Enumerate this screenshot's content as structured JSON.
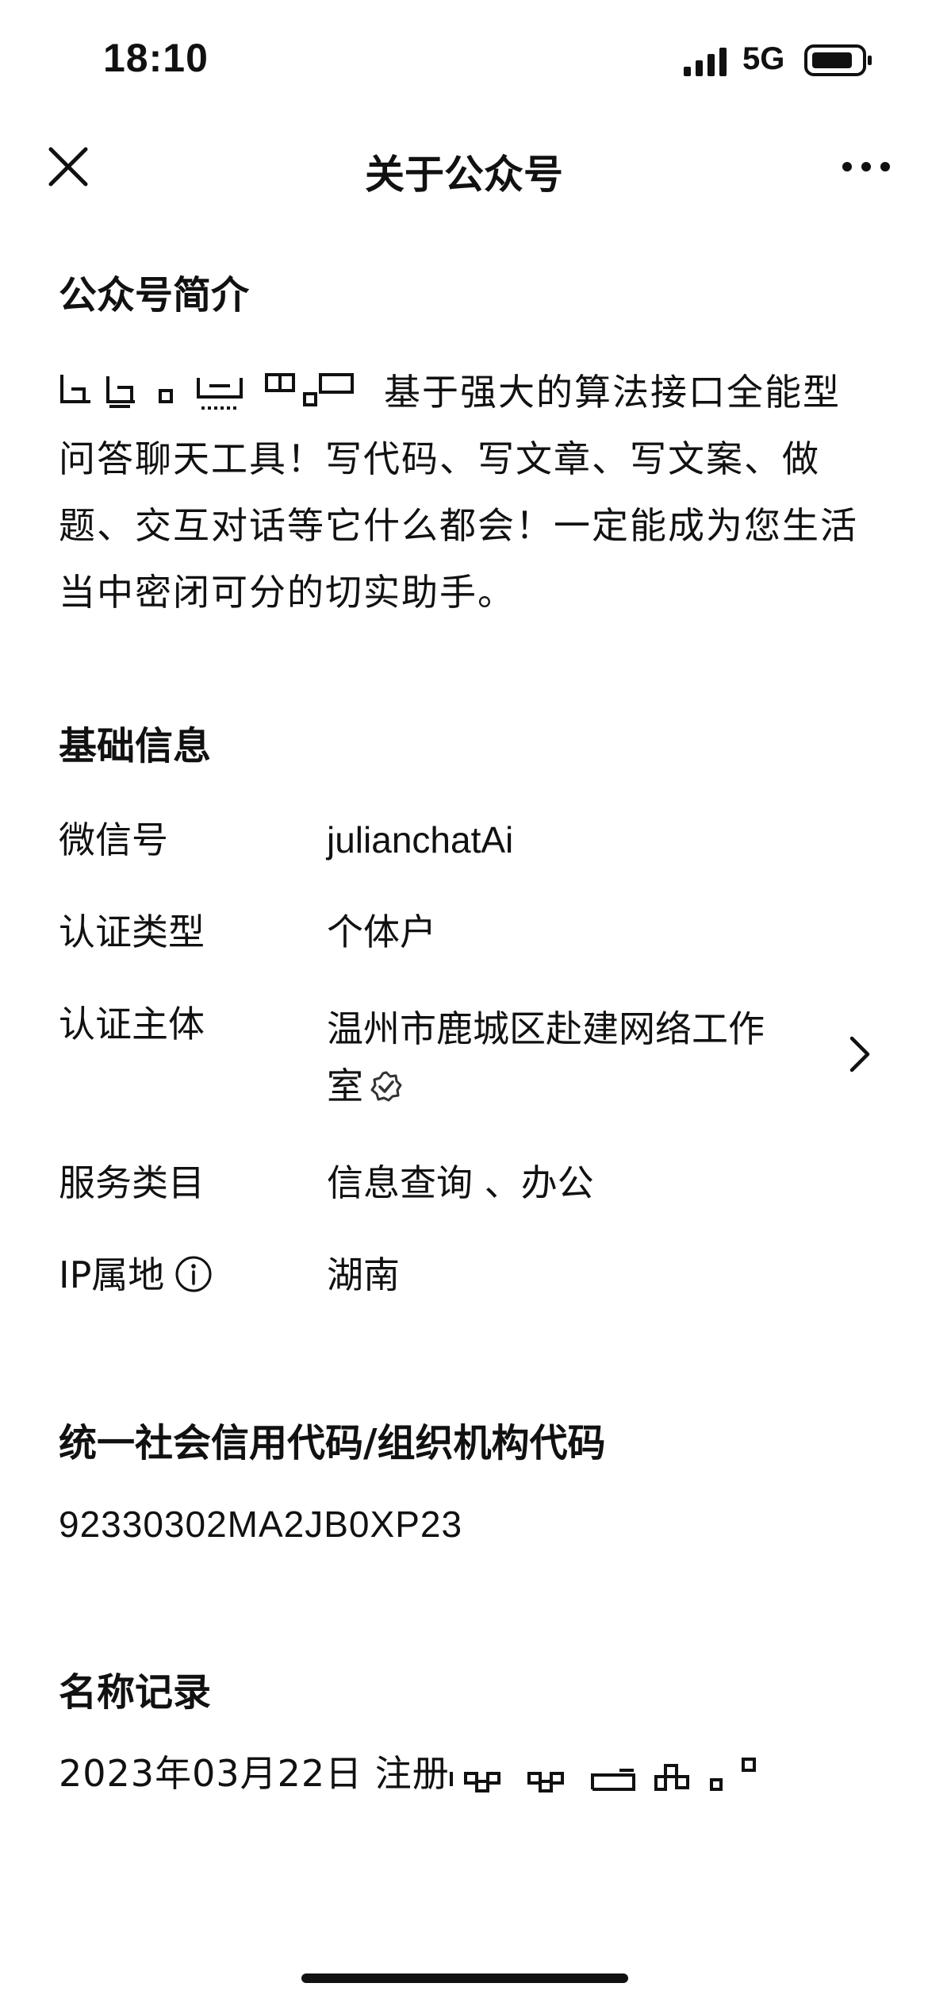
{
  "status_bar": {
    "time": "18:10",
    "network": "5G",
    "signal_icon": "signal-bars-icon",
    "battery_icon": "battery-icon"
  },
  "nav": {
    "title": "关于公众号",
    "close_icon": "close-icon",
    "more_icon": "more-dots-icon"
  },
  "intro": {
    "title": "公众号简介",
    "text": "基于强大的算法接口全能型问答聊天工具！写代码、写文章、写文案、做题、交互对话等它什么都会！一定能成为您生活当中密闭可分的切实助手。"
  },
  "basic_info": {
    "title": "基础信息",
    "rows": [
      {
        "label": "微信号",
        "value": "julianchatAi"
      },
      {
        "label": "认证类型",
        "value": "个体户"
      },
      {
        "label": "认证主体",
        "value": "温州市鹿城区赴建网络工作室"
      },
      {
        "label": "服务类目",
        "value": "信息查询 、办公"
      },
      {
        "label": "IP属地",
        "value": "湖南"
      }
    ]
  },
  "credit_code": {
    "title": "统一社会信用代码/组织机构代码",
    "value": "92330302MA2JB0XP23"
  },
  "name_record": {
    "title": "名称记录",
    "value": "2023年03月22日 注册"
  },
  "colors": {
    "text": "#111111",
    "background": "#ffffff"
  }
}
